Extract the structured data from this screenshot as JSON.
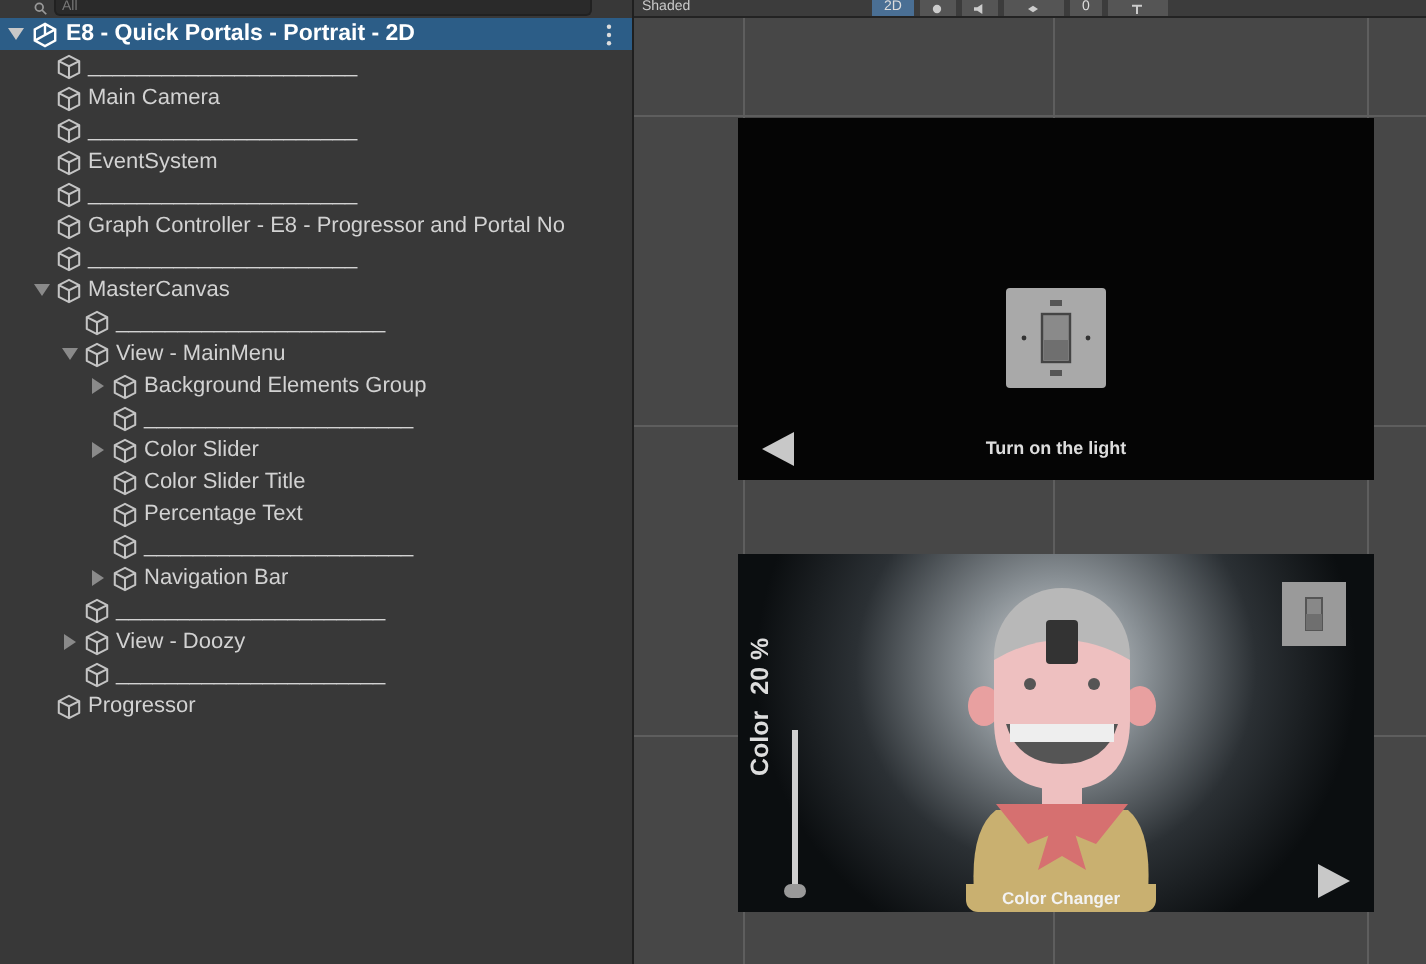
{
  "hierarchy": {
    "search": {
      "placeholder": "All"
    },
    "scene": {
      "name": "E8 - Quick Portals - Portrait - 2D",
      "selected": true,
      "expanded": true,
      "children": [
        {
          "name": "______________________"
        },
        {
          "name": "Main Camera"
        },
        {
          "name": "______________________"
        },
        {
          "name": "EventSystem"
        },
        {
          "name": "______________________"
        },
        {
          "name": "Graph Controller - E8 - Progressor and Portal No"
        },
        {
          "name": "______________________"
        },
        {
          "name": "MasterCanvas",
          "expanded": true,
          "children": [
            {
              "name": "______________________"
            },
            {
              "name": "View - MainMenu",
              "expanded": true,
              "children": [
                {
                  "name": "Background Elements Group",
                  "expanded": false
                },
                {
                  "name": "______________________"
                },
                {
                  "name": "Color Slider",
                  "expanded": false
                },
                {
                  "name": "Color Slider Title"
                },
                {
                  "name": "Percentage Text"
                },
                {
                  "name": "______________________"
                },
                {
                  "name": "Navigation Bar",
                  "expanded": false
                }
              ]
            },
            {
              "name": "______________________"
            },
            {
              "name": "View - Doozy",
              "expanded": false
            },
            {
              "name": "______________________"
            }
          ]
        },
        {
          "name": "Progressor"
        }
      ]
    }
  },
  "scene_view": {
    "toolbar": {
      "shading_mode": "Shaded",
      "mode_2d": {
        "label": "2D",
        "selected": true
      },
      "lighting": {
        "on": false
      },
      "audio": {
        "on": false
      },
      "gizmo_count": "0"
    },
    "top_view": {
      "caption": "Turn on the light"
    },
    "bottom_view": {
      "slider_title": "Color",
      "slider_reading": "20 %",
      "slider": {
        "level": 0
      },
      "button_label": "Color Changer"
    }
  }
}
